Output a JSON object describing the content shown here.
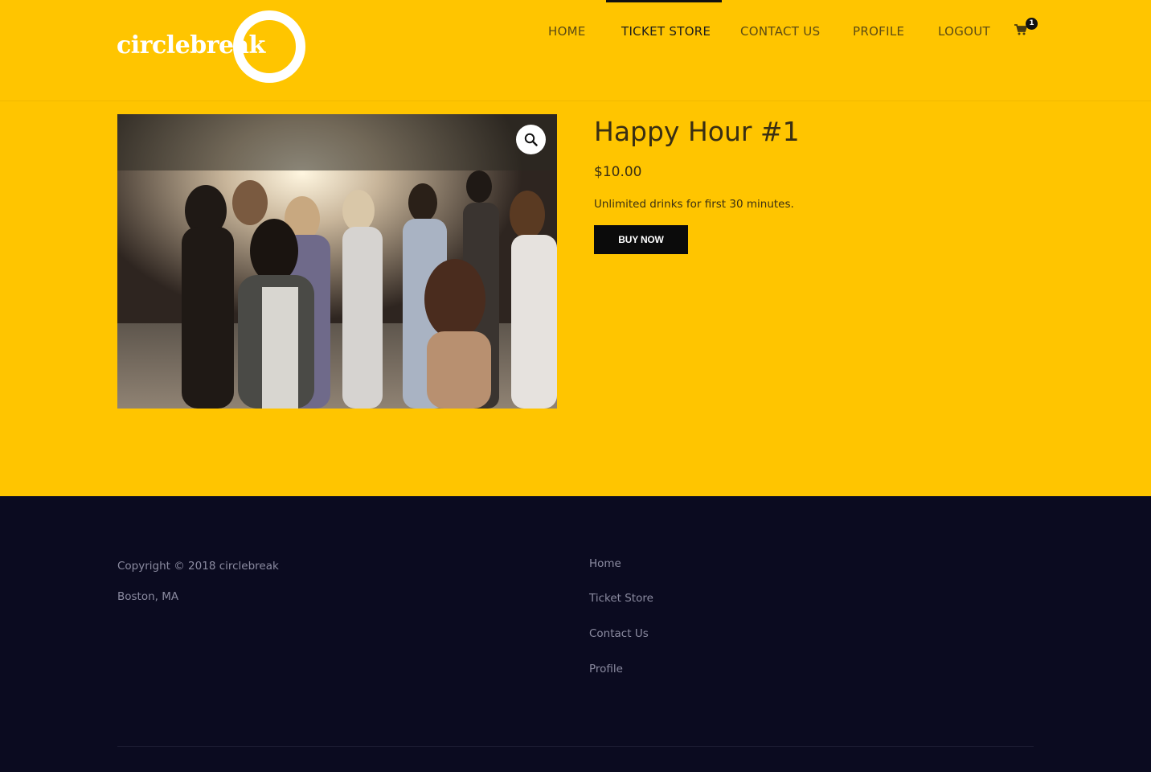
{
  "brand": {
    "name": "circlebreak",
    "logo_text": "circlebreak"
  },
  "nav": {
    "items": [
      {
        "label": "HOME",
        "active": false
      },
      {
        "label": "TICKET STORE",
        "active": true
      },
      {
        "label": "CONTACT US",
        "active": false
      },
      {
        "label": "PROFILE",
        "active": false
      },
      {
        "label": "LOGOUT",
        "active": false
      }
    ],
    "cart_icon": "cart-icon",
    "cart_count": "1"
  },
  "product": {
    "title": "Happy Hour #1",
    "price": "$10.00",
    "description": "Unlimited drinks for first 30 minutes.",
    "buy_label": "BUY NOW",
    "zoom_icon": "magnifier-icon"
  },
  "footer": {
    "copyright": "Copyright © 2018 circlebreak",
    "location": "Boston, MA",
    "links": [
      "Home",
      "Ticket Store",
      "Contact Us",
      "Profile"
    ]
  },
  "colors": {
    "accent": "#ffc500",
    "footer_bg": "#0b0b20",
    "button_bg": "#0b0b0b"
  }
}
